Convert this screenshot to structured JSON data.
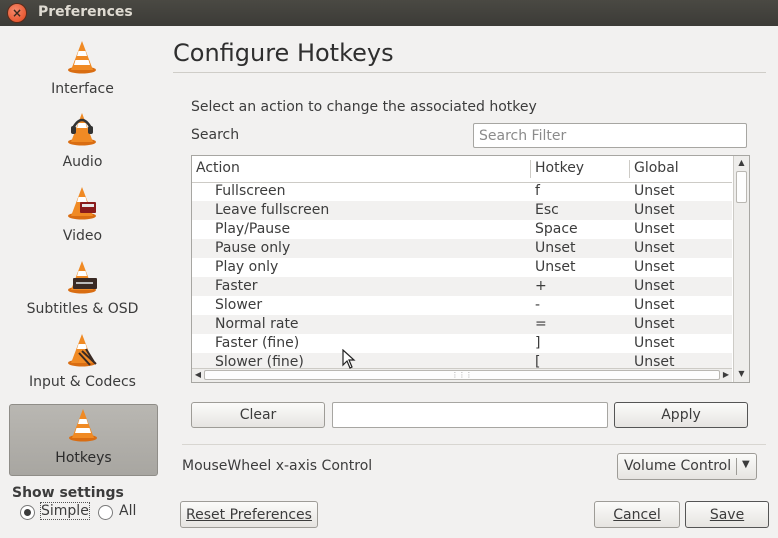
{
  "window": {
    "title": "Preferences",
    "close_glyph": "×"
  },
  "sidebar": {
    "items": [
      {
        "label": "Interface",
        "icon": "vlc-cone-icon"
      },
      {
        "label": "Audio",
        "icon": "vlc-cone-headphones-icon"
      },
      {
        "label": "Video",
        "icon": "vlc-cone-video-icon"
      },
      {
        "label": "Subtitles & OSD",
        "icon": "vlc-cone-subtitles-icon"
      },
      {
        "label": "Input & Codecs",
        "icon": "vlc-cone-input-icon"
      },
      {
        "label": "Hotkeys",
        "icon": "vlc-cone-hotkeys-icon",
        "active": true
      }
    ],
    "show_settings_label": "Show settings",
    "simple_label": "Simple",
    "all_label": "All",
    "selected": "Simple"
  },
  "main": {
    "heading": "Configure Hotkeys",
    "instruction": "Select an action to change the associated hotkey",
    "search_label": "Search",
    "search_placeholder": "Search Filter",
    "table": {
      "columns": [
        "Action",
        "Hotkey",
        "Global"
      ],
      "rows": [
        [
          "Fullscreen",
          "f",
          "Unset"
        ],
        [
          "Leave fullscreen",
          "Esc",
          "Unset"
        ],
        [
          "Play/Pause",
          "Space",
          "Unset"
        ],
        [
          "Pause only",
          "Unset",
          "Unset"
        ],
        [
          "Play only",
          "Unset",
          "Unset"
        ],
        [
          "Faster",
          "+",
          "Unset"
        ],
        [
          "Slower",
          "-",
          "Unset"
        ],
        [
          "Normal rate",
          "=",
          "Unset"
        ],
        [
          "Faster (fine)",
          "]",
          "Unset"
        ],
        [
          "Slower (fine)",
          "[",
          "Unset"
        ]
      ]
    },
    "clear_button": "Clear",
    "apply_button": "Apply",
    "hotkey_value": "",
    "mousewheel_label": "MouseWheel x-axis Control",
    "mousewheel_value": "Volume Control"
  },
  "footer": {
    "reset_button": "Reset Preferences",
    "cancel_button": "Cancel",
    "save_button": "Save"
  },
  "colors": {
    "accent_orange": "#f08a24",
    "titlebar": "#3c3b37",
    "close": "#e2451b"
  }
}
